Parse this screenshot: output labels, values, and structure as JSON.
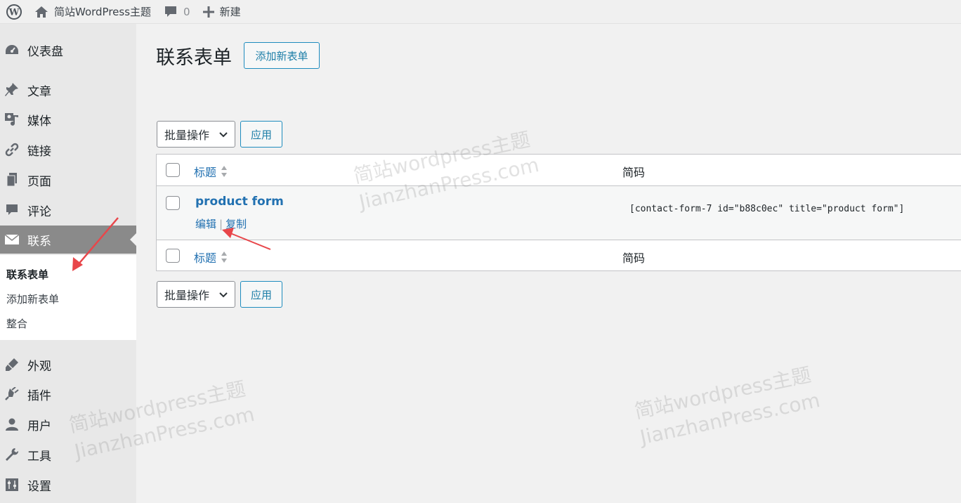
{
  "adminbar": {
    "site_name": "简站WordPress主题",
    "comments_count": "0",
    "new_label": "新建"
  },
  "sidebar": {
    "items": [
      {
        "label": "仪表盘",
        "icon": "dashboard-icon"
      },
      {
        "label": "文章",
        "icon": "pin-icon"
      },
      {
        "label": "媒体",
        "icon": "media-icon"
      },
      {
        "label": "链接",
        "icon": "link-icon"
      },
      {
        "label": "页面",
        "icon": "page-icon"
      },
      {
        "label": "评论",
        "icon": "comment-icon"
      },
      {
        "label": "联系",
        "icon": "mail-icon"
      },
      {
        "label": "外观",
        "icon": "brush-icon"
      },
      {
        "label": "插件",
        "icon": "plugin-icon"
      },
      {
        "label": "用户",
        "icon": "user-icon"
      },
      {
        "label": "工具",
        "icon": "wrench-icon"
      },
      {
        "label": "设置",
        "icon": "settings-icon"
      }
    ],
    "submenu": [
      "联系表单",
      "添加新表单",
      "整合"
    ]
  },
  "main": {
    "title": "联系表单",
    "add_new": "添加新表单",
    "bulk_action": "批量操作",
    "apply": "应用",
    "columns": {
      "title": "标题",
      "shortcode": "简码"
    },
    "rows": [
      {
        "title": "product form",
        "edit": "编辑",
        "sep": "|",
        "duplicate": "复制",
        "shortcode": "[contact-form-7 id=\"b88c0ec\" title=\"product form\"]"
      }
    ]
  },
  "watermark": {
    "line1": "简站wordpress主题",
    "line2": "JianzhanPress.com"
  }
}
